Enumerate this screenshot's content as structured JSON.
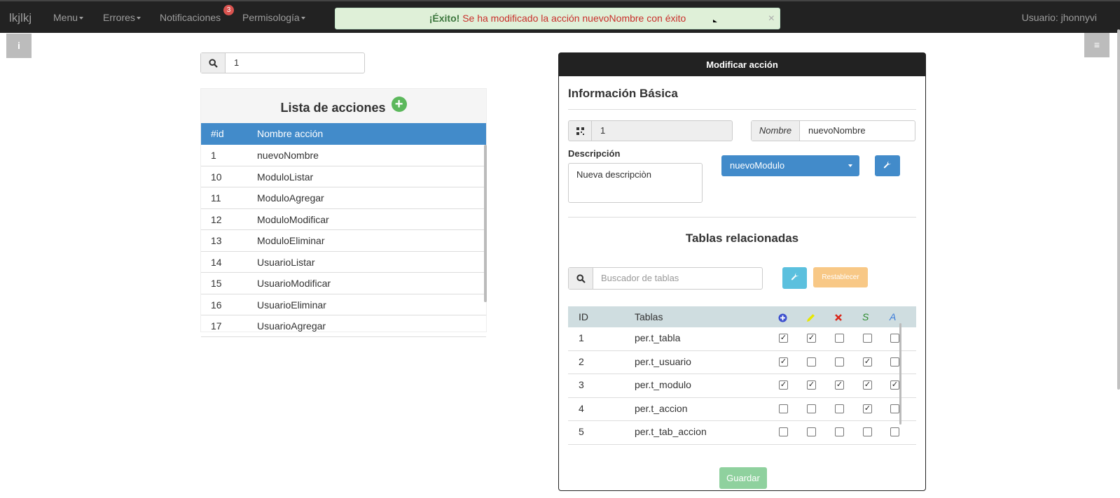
{
  "navbar": {
    "brand": "lkjlkj",
    "menu": "Menu",
    "errores": "Errores",
    "notificaciones": "Notificaciones",
    "notif_count": "3",
    "permisologia": "Permisología",
    "user": "Usuario: jhonnyvi"
  },
  "alert": {
    "strong": "¡Éxito!",
    "message": "Se ha modificado la acción nuevoNombre con éxito",
    "close": "×"
  },
  "side": {
    "info": "i",
    "menu": "≡"
  },
  "search": {
    "value": "1"
  },
  "list": {
    "title": "Lista de acciones",
    "add": "+",
    "col_id": "#id",
    "col_name": "Nombre acción",
    "rows": [
      {
        "id": "1",
        "name": "nuevoNombre"
      },
      {
        "id": "10",
        "name": "ModuloListar"
      },
      {
        "id": "11",
        "name": "ModuloAgregar"
      },
      {
        "id": "12",
        "name": "ModuloModificar"
      },
      {
        "id": "13",
        "name": "ModuloEliminar"
      },
      {
        "id": "14",
        "name": "UsuarioListar"
      },
      {
        "id": "15",
        "name": "UsuarioModificar"
      },
      {
        "id": "16",
        "name": "UsuarioEliminar"
      },
      {
        "id": "17",
        "name": "UsuarioAgregar"
      }
    ]
  },
  "form": {
    "title": "Modificar acción",
    "section": "Información Básica",
    "id_value": "1",
    "name_label": "Nombre",
    "name_value": "nuevoNombre",
    "desc_label": "Descripción",
    "desc_value": "Nueva descripciòn",
    "module": "nuevoModulo",
    "tables_title": "Tablas relacionadas",
    "tables_placeholder": "Buscador de tablas",
    "reset": "Restablecer",
    "save": "Guardar",
    "col_id": "ID",
    "col_tables": "Tablas",
    "perm_icons": [
      "plus-circle-icon",
      "pencil-icon",
      "times-icon",
      "S",
      "A"
    ],
    "perm_colors": [
      "#3c4fce",
      "#e8e800",
      "#d9281c",
      "#2a8a2a",
      "#3c7bd9"
    ],
    "rows": [
      {
        "id": "1",
        "name": "per.t_tabla",
        "perms": [
          true,
          true,
          false,
          false,
          false
        ]
      },
      {
        "id": "2",
        "name": "per.t_usuario",
        "perms": [
          true,
          false,
          false,
          true,
          false
        ]
      },
      {
        "id": "3",
        "name": "per.t_modulo",
        "perms": [
          true,
          true,
          true,
          true,
          true
        ]
      },
      {
        "id": "4",
        "name": "per.t_accion",
        "perms": [
          false,
          false,
          false,
          true,
          false
        ]
      },
      {
        "id": "5",
        "name": "per.t_tab_accion",
        "perms": [
          false,
          false,
          false,
          false,
          false
        ]
      }
    ]
  }
}
